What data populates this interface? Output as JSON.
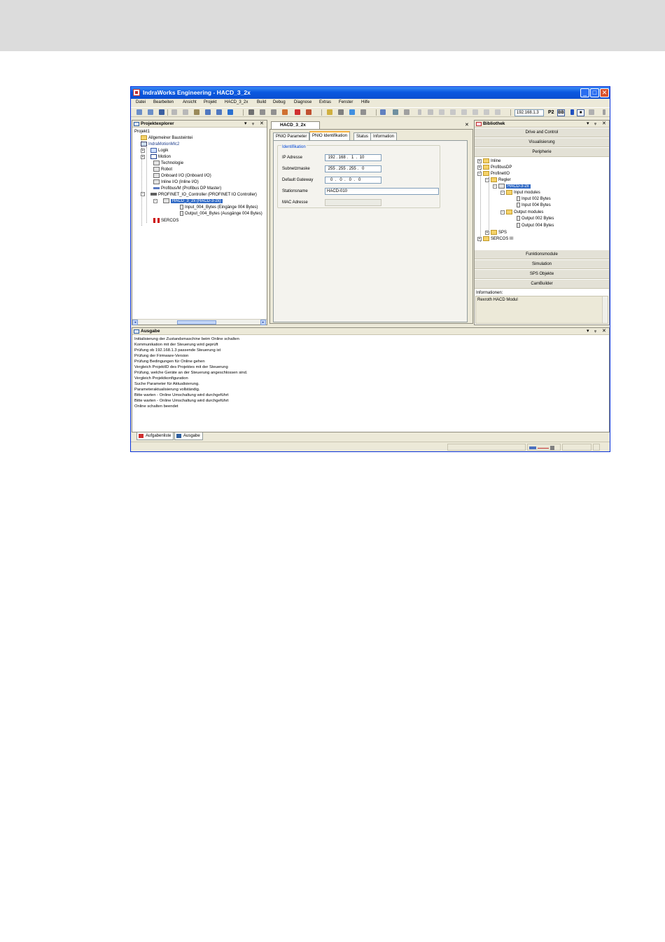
{
  "window": {
    "title": "IndraWorks Engineering - HACD_3_2x",
    "controls": [
      "minimize",
      "maximize",
      "close"
    ]
  },
  "menu": [
    "Datei",
    "Bearbeiten",
    "Ansicht",
    "Projekt",
    "HACD_3_2x",
    "Build",
    "Debug",
    "Diagnose",
    "Extras",
    "Fenster",
    "Hilfe"
  ],
  "toolbar": {
    "ip_address": "192.168.1.3",
    "p2_label": "P2",
    "bb_label": "BB"
  },
  "project_explorer": {
    "title": "Projektexplorer",
    "items": [
      {
        "label": "Projekt1",
        "icon": "project-icon"
      },
      {
        "label": "Allgemeiner Bausteintei",
        "icon": "folder-icon"
      },
      {
        "label": "IndraMotionMlc2",
        "icon": "controller-icon"
      },
      {
        "label": "Logik",
        "icon": "logic-icon"
      },
      {
        "label": "Motion",
        "icon": "motion-icon"
      },
      {
        "label": "Technologie",
        "icon": "technology-icon"
      },
      {
        "label": "Robot",
        "icon": "robot-icon"
      },
      {
        "label": "Onboard I/O (Onboard I/O)",
        "icon": "io-icon"
      },
      {
        "label": "Inline I/O (Inline I/O)",
        "icon": "io-icon"
      },
      {
        "label": "Profibus/M (Profibus DP Master)",
        "icon": "bus-icon"
      },
      {
        "label": "PROFINET_IO_Controller (PROFINET IO Controller)",
        "icon": "bus-icon"
      },
      {
        "label": "HACD_3_2x (HACD-3-2x)",
        "icon": "device-icon"
      },
      {
        "label": "Input_004_Bytes (Eingänge 004 Bytes)",
        "icon": "module-icon"
      },
      {
        "label": "Output_004_Bytes (Ausgänge 004 Bytes)",
        "icon": "module-icon"
      },
      {
        "label": "SERCOS",
        "icon": "sercos-icon"
      }
    ]
  },
  "editor": {
    "doc_tab": "HACD_3_2x",
    "tabs": [
      "PNIO Parameter",
      "PNIO Identifikation",
      "Status",
      "Information"
    ],
    "active_tab": "PNIO Identifikation",
    "group_title": "Identifikation",
    "fields": [
      {
        "label": "IP Adresse",
        "value": " 192 . 168 .   1  .  10"
      },
      {
        "label": "Subnetzmaske",
        "value": " 255 . 255 . 255 .   0"
      },
      {
        "label": "Default Gateway",
        "value": "   0  .   0  .   0  .   0"
      },
      {
        "label": "Stationsname",
        "value": "HACD-010"
      },
      {
        "label": "MAC Adresse",
        "value": ""
      }
    ]
  },
  "library": {
    "title": "Bibliothek",
    "sections_top": [
      "Drive and Control",
      "Visualisierung",
      "Peripherie"
    ],
    "tree": [
      {
        "label": "Inline"
      },
      {
        "label": "ProfibusDP"
      },
      {
        "label": "ProfinetIO"
      },
      {
        "label": "Regler"
      },
      {
        "label": "HACD-3-2x"
      },
      {
        "label": "Input modules"
      },
      {
        "label": "Input 002 Bytes"
      },
      {
        "label": "Input 004 Bytes"
      },
      {
        "label": "Output modules"
      },
      {
        "label": "Output 002 Bytes"
      },
      {
        "label": "Output 004 Bytes"
      },
      {
        "label": "SPS"
      },
      {
        "label": "SERCOS III"
      }
    ],
    "sections_bottom": [
      "Funktionsmodule",
      "Simulation",
      "SPS Objekte",
      "CamBuilder"
    ],
    "info_label": "Informationen:",
    "info_text": "Rexroth HACD Modul"
  },
  "output": {
    "title": "Ausgabe",
    "lines": [
      "Initialisierung der Zustandsmaschine beim Online schalten",
      "Kommunikation mit der Steuerung wird geprüft",
      "Prüfung ob 192.168.1.3 passende Steuerung ist",
      "Prüfung der Firmware-Version",
      "Prüfung Bedingungen für Online gehen",
      "Vergleich ProjektID des Projektes mit der Steuerung",
      "Prüfung, welche Geräte an der Steuerung angeschlossen sind.",
      "Vergleich Projektkonfiguration",
      "Suche Parameter für Aktualisierung.",
      "Parameteraktualisierung vollständig.",
      "Bitte warten - Online Umschaltung wird durchgeführt",
      "Bitte warten - Online Umschaltung wird durchgeführt",
      "Online schalten beendet"
    ]
  },
  "bottom_tabs": [
    "Aufgabenliste",
    "Ausgabe"
  ],
  "colors": {
    "titlebar": "#0a58e0",
    "selection": "#316ac5",
    "chrome": "#ece9d8",
    "sercos_red": "#cc0000"
  }
}
